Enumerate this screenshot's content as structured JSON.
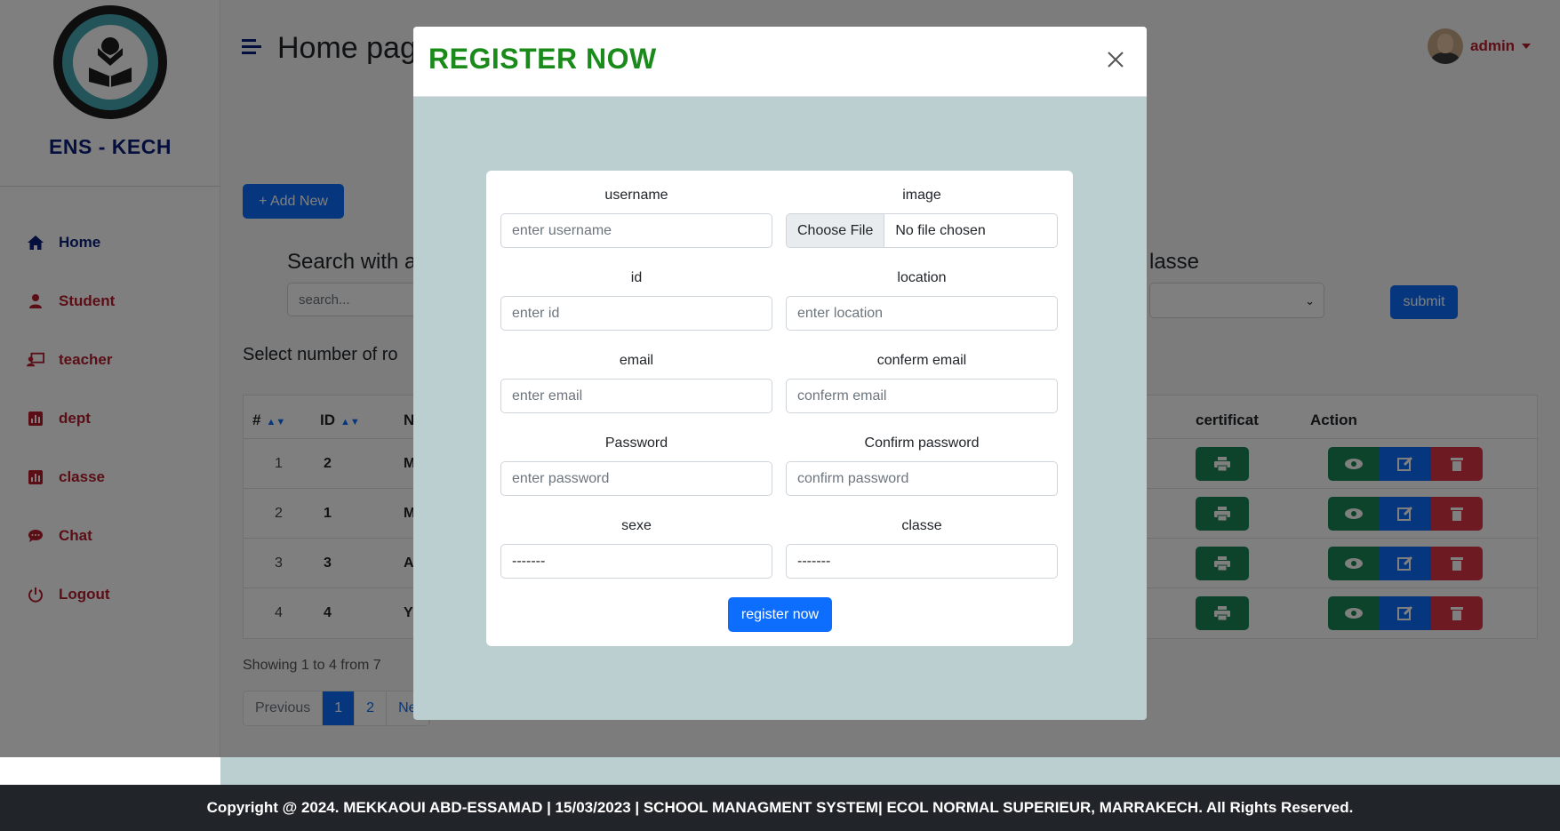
{
  "sidebar": {
    "brand": "ENS - KECH",
    "items": [
      {
        "label": "Home",
        "icon": "home-icon"
      },
      {
        "label": "Student",
        "icon": "user-icon"
      },
      {
        "label": "teacher",
        "icon": "teacher-icon"
      },
      {
        "label": "dept",
        "icon": "chart-icon"
      },
      {
        "label": "classe",
        "icon": "chart-icon"
      },
      {
        "label": "Chat",
        "icon": "chat-icon"
      },
      {
        "label": "Logout",
        "icon": "power-icon"
      }
    ]
  },
  "header": {
    "title": "Home pag",
    "user": "admin"
  },
  "toolbar": {
    "add_label": "+ Add New",
    "search_title": "Search with a",
    "search_placeholder": "search...",
    "classe_title": "lasse",
    "submit_label": "submit",
    "rows_label": "Select number of ro"
  },
  "table": {
    "headers": {
      "num": "#",
      "id": "ID",
      "name": "N",
      "certificat": "certificat",
      "action": "Action"
    },
    "rows": [
      {
        "num": "1",
        "id": "2",
        "name": "M"
      },
      {
        "num": "2",
        "id": "1",
        "name": "M"
      },
      {
        "num": "3",
        "id": "3",
        "name": "A"
      },
      {
        "num": "4",
        "id": "4",
        "name": "Y"
      }
    ]
  },
  "pagination": {
    "showing": "Showing 1 to 4 from 7",
    "prev": "Previous",
    "pages": [
      "1",
      "2"
    ],
    "next": "Ne"
  },
  "modal": {
    "title": "REGISTER NOW",
    "fields": {
      "username": {
        "label": "username",
        "placeholder": "enter username"
      },
      "image": {
        "label": "image",
        "button": "Choose File",
        "status": "No file chosen"
      },
      "id": {
        "label": "id",
        "placeholder": "enter id"
      },
      "location": {
        "label": "location",
        "placeholder": "enter location"
      },
      "email": {
        "label": "email",
        "placeholder": "enter email"
      },
      "conferm_email": {
        "label": "conferm email",
        "placeholder": "conferm email"
      },
      "password": {
        "label": "Password",
        "placeholder": "enter password"
      },
      "confirm_password": {
        "label": "Confirm password",
        "placeholder": "confirm password"
      },
      "sexe": {
        "label": "sexe",
        "value": "-------"
      },
      "classe": {
        "label": "classe",
        "value": "-------"
      }
    },
    "submit_label": "register now"
  },
  "footer": {
    "text": "Copyright @ 2024. MEKKAOUI ABD-ESSAMAD | 15/03/2023 | SCHOOL MANAGMENT SYSTEM| ECOL NORMAL SUPERIEUR, MARRAKECH. All Rights Reserved."
  },
  "colors": {
    "primary": "#0d6efd",
    "success": "#198754",
    "danger": "#dc3545",
    "brand_navy": "#0b1f7a",
    "nav_red": "#b71c2c",
    "modal_title_green": "#1a8a1a",
    "modal_body_bg": "#bccfd0"
  }
}
